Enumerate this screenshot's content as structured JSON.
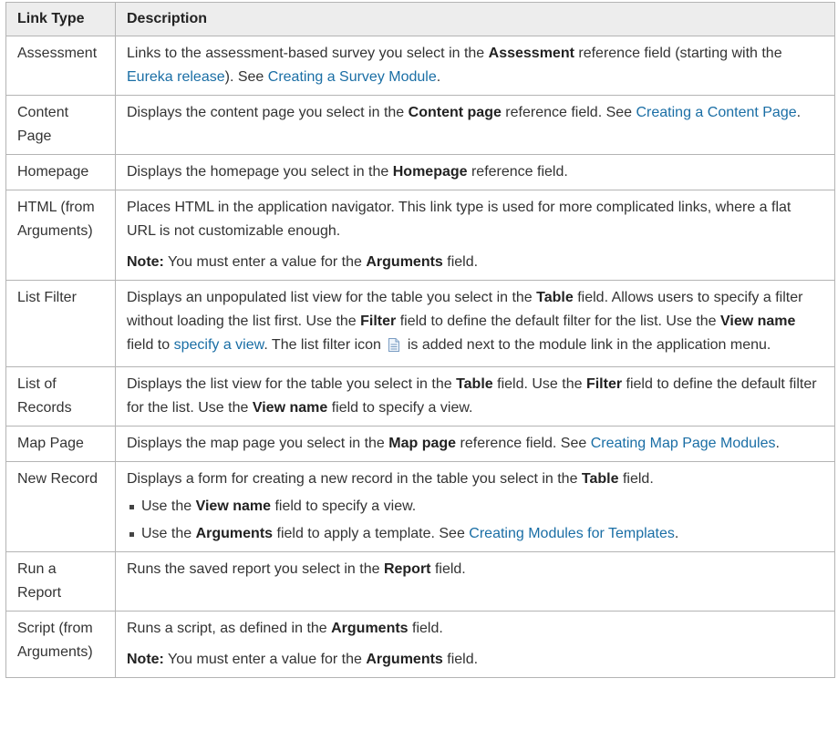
{
  "header": {
    "col1": "Link Type",
    "col2": "Description"
  },
  "rows": {
    "assessment": {
      "type": "Assessment",
      "t1": "Links to the assessment-based survey you select in the ",
      "b1": "Assessment",
      "t2": " reference field (starting with the ",
      "link1": "Eureka release",
      "t3": "). See ",
      "link2": "Creating a Survey Module",
      "t4": "."
    },
    "content_page": {
      "type": "Content Page",
      "t1": "Displays the content page you select in the ",
      "b1": "Content page",
      "t2": " reference field. See ",
      "link1": "Creating a Content Page",
      "t3": "."
    },
    "homepage": {
      "type": "Homepage",
      "t1": "Displays the homepage you select in the ",
      "b1": "Homepage",
      "t2": " reference field."
    },
    "html": {
      "type": "HTML (from Arguments)",
      "t1": "Places HTML in the application navigator. This link type is used for more complicated links, where a flat URL is not customizable enough.",
      "note_label": "Note:",
      "note_t1": " You must enter a value for the ",
      "note_b1": "Arguments",
      "note_t2": " field."
    },
    "list_filter": {
      "type": "List Filter",
      "t1": "Displays an unpopulated list view for the table you select in the ",
      "b1": "Table",
      "t2": " field. Allows users to specify a filter without loading the list first. Use the ",
      "b2": "Filter",
      "t3": " field to define the default filter for the list. Use the ",
      "b3": "View name",
      "t4": " field to ",
      "link1": "specify a view",
      "t5": ". The list filter icon ",
      "icon": "list-filter-icon",
      "t6": " is added next to the module link in the application menu."
    },
    "list_of_records": {
      "type": "List of Records",
      "t1": "Displays the list view for the table you select in the ",
      "b1": "Table",
      "t2": " field. Use the ",
      "b2": "Filter",
      "t3": " field to define the default filter for the list. Use the ",
      "b3": "View name",
      "t4": " field to specify a view."
    },
    "map_page": {
      "type": "Map Page",
      "t1": "Displays the map page you select in the ",
      "b1": "Map page",
      "t2": " reference field. See ",
      "link1": "Creating Map Page Modules",
      "t3": "."
    },
    "new_record": {
      "type": "New Record",
      "t1": "Displays a form for creating a new record in the table you select in the ",
      "b1": "Table",
      "t2": " field.",
      "bullet1_t1": "Use the ",
      "bullet1_b1": "View name",
      "bullet1_t2": " field to specify a view.",
      "bullet2_t1": "Use the ",
      "bullet2_b1": "Arguments",
      "bullet2_t2": " field to apply a template. See ",
      "bullet2_link": "Creating Modules for Templates",
      "bullet2_t3": "."
    },
    "run_report": {
      "type": "Run a Report",
      "t1": "Runs the saved report you select in the ",
      "b1": "Report",
      "t2": " field."
    },
    "script": {
      "type": "Script (from Arguments)",
      "t1": "Runs a script, as defined in the ",
      "b1": "Arguments",
      "t2": " field.",
      "note_label": "Note:",
      "note_t1": " You must enter a value for the ",
      "note_b1": "Arguments",
      "note_t2": " field."
    }
  },
  "colors": {
    "link": "#1a6ea5",
    "header_bg": "#ededed",
    "border": "#b4b4b4",
    "text": "#333333"
  }
}
